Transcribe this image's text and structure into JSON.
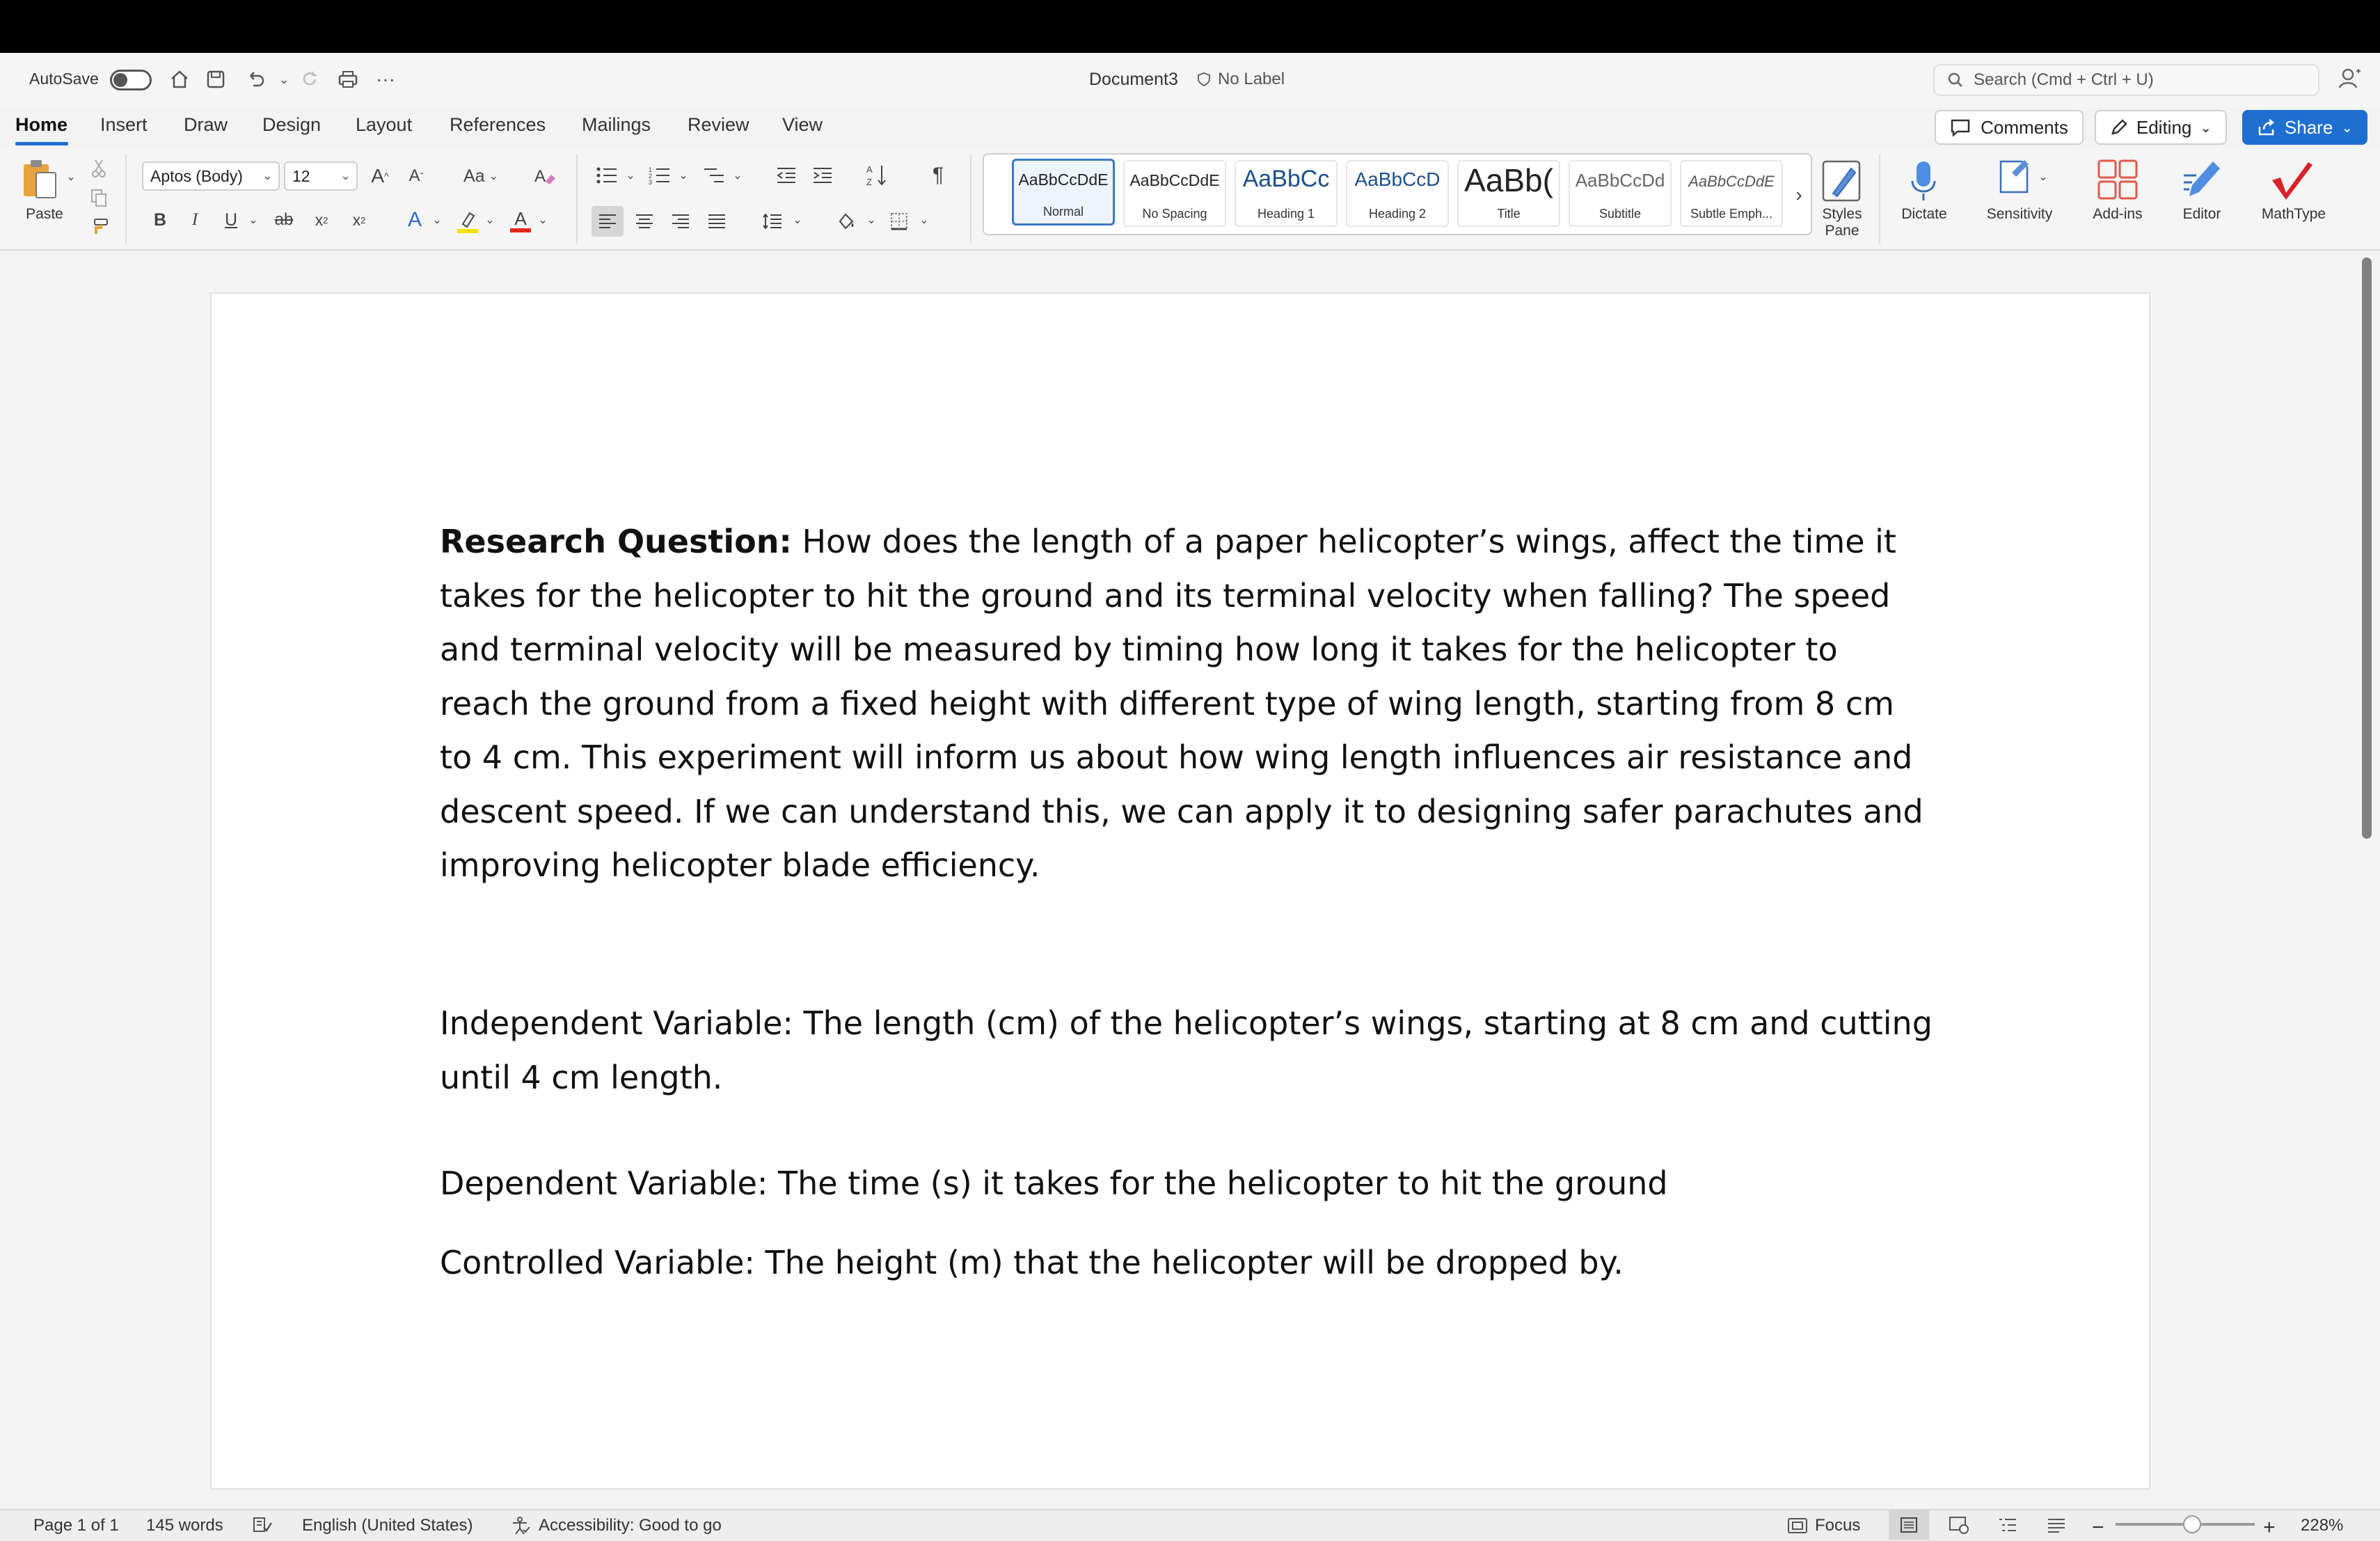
{
  "window": {
    "autosave_label": "AutoSave",
    "document_title": "Document3",
    "label_status": "No Label",
    "search_placeholder": "Search (Cmd + Ctrl + U)"
  },
  "tabs": [
    "Home",
    "Insert",
    "Draw",
    "Design",
    "Layout",
    "References",
    "Mailings",
    "Review",
    "View"
  ],
  "actions": {
    "comments": "Comments",
    "editing": "Editing",
    "share": "Share"
  },
  "ribbon": {
    "paste_label": "Paste",
    "font_name": "Aptos (Body)",
    "font_size": "12",
    "change_case": "Aa",
    "bold": "B",
    "italic": "I",
    "underline": "U",
    "strikethrough": "ab",
    "subscript": "x",
    "superscript": "x",
    "text_effects": "A",
    "font_color": "A",
    "styles": [
      {
        "preview": "AaBbCcDdE",
        "name": "Normal"
      },
      {
        "preview": "AaBbCcDdE",
        "name": "No Spacing"
      },
      {
        "preview": "AaBbCc",
        "name": "Heading 1"
      },
      {
        "preview": "AaBbCcD",
        "name": "Heading 2"
      },
      {
        "preview": "AaBb(",
        "name": "Title"
      },
      {
        "preview": "AaBbCcDd",
        "name": "Subtitle"
      },
      {
        "preview": "AaBbCcDdE",
        "name": "Subtle Emph..."
      }
    ],
    "styles_pane_label": "Styles Pane",
    "dictate_label": "Dictate",
    "sensitivity_label": "Sensitivity",
    "addins_label": "Add-ins",
    "editor_label": "Editor",
    "mathtype_label": "MathType"
  },
  "document": {
    "rq_label": "Research Question:",
    "rq_text": " How does the length of a paper helicopter’s wings, affect the time it takes for the helicopter to hit the ground and its terminal velocity when falling? The speed and terminal velocity will be measured by timing how long it takes for the helicopter to reach the ground from a fixed height with different type of wing length, starting from 8 cm to 4 cm. This experiment will inform us about how wing length influences air resistance and descent speed. If we can understand this, we can apply it to designing safer parachutes and improving helicopter blade efficiency.",
    "independent": "Independent Variable: The length (cm) of the helicopter’s wings, starting at 8 cm and cutting until 4 cm length.",
    "dependent": "Dependent Variable: The time (s) it takes for the helicopter to hit the ground",
    "controlled": "Controlled Variable: The height (m) that the helicopter will be dropped by."
  },
  "status": {
    "page": "Page 1 of 1",
    "words": "145 words",
    "language": "English (United States)",
    "accessibility": "Accessibility: Good to go",
    "focus": "Focus",
    "zoom": "228%",
    "zoom_level_fraction": 0.55
  },
  "colors": {
    "accent": "#1f6fd1",
    "highlight_yellow": "#f5e100",
    "font_red": "#e0281b",
    "mathtype_red": "#d8232a"
  }
}
